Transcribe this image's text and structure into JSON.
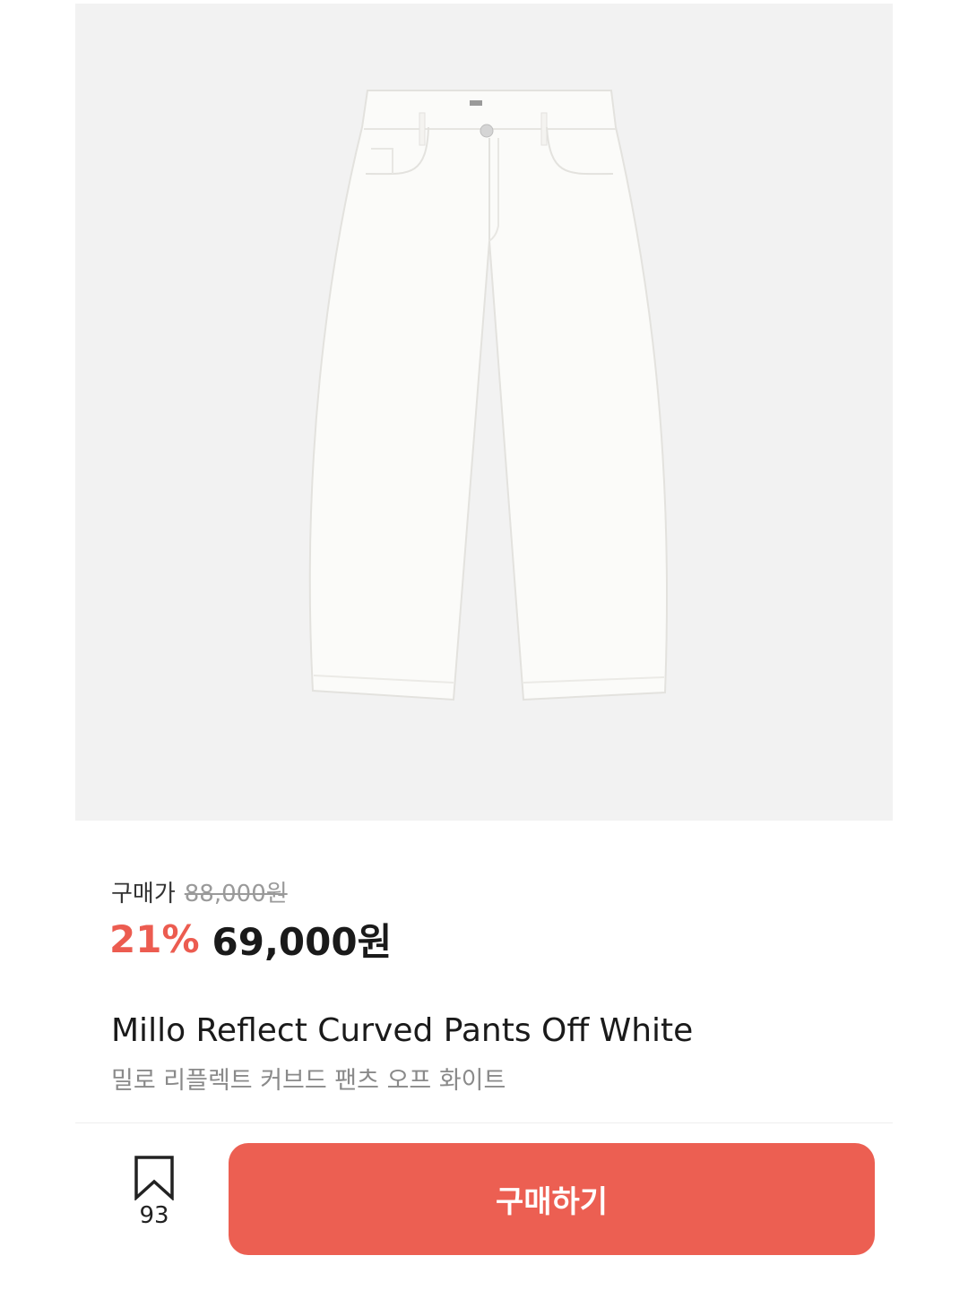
{
  "product_image": {
    "alt": "Millo Reflect Curved Pants Off White"
  },
  "pricing": {
    "label": "구매가",
    "original_price": "88,000원",
    "discount": "21%",
    "sale_price": "69,000원"
  },
  "product": {
    "name_en": "Millo Reflect Curved Pants Off White",
    "name_ko": "밀로 리플렉트 커브드 팬츠 오프 화이트"
  },
  "actions": {
    "bookmark_count": "93",
    "buy_label": "구매하기"
  },
  "colors": {
    "accent": "#ec5f52",
    "discount": "#ec5c50",
    "image_background": "#f2f2f2"
  }
}
